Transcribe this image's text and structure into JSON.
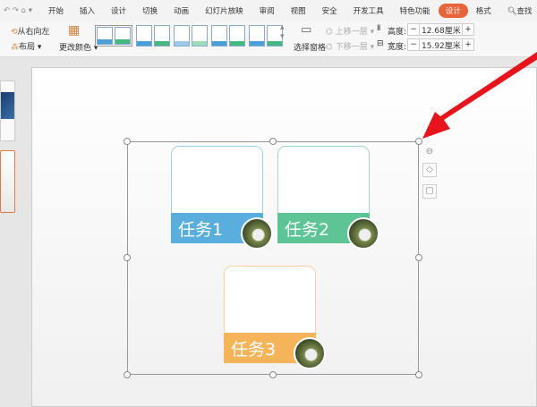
{
  "tabs": [
    "开始",
    "插入",
    "设计",
    "切换",
    "动画",
    "幻灯片放映",
    "审阅",
    "视图",
    "安全",
    "开发工具",
    "特色功能",
    "设计",
    "格式",
    "查找"
  ],
  "ribbon": {
    "right_to_left": "从右向左",
    "layout": "布局",
    "change_color": "更改颜色",
    "selection_pane": "选择窗格",
    "bring_forward": "上移一层",
    "send_backward": "下移一层",
    "height_label": "高度:",
    "height_value": "12.68厘米",
    "width_label": "宽度:",
    "width_value": "15.92厘米"
  },
  "cards": [
    {
      "label": "任务1",
      "color": "#5aaede"
    },
    {
      "label": "任务2",
      "color": "#5cc495"
    },
    {
      "label": "任务3",
      "color": "#f5b35a"
    }
  ],
  "arrow_color": "#e8141b"
}
